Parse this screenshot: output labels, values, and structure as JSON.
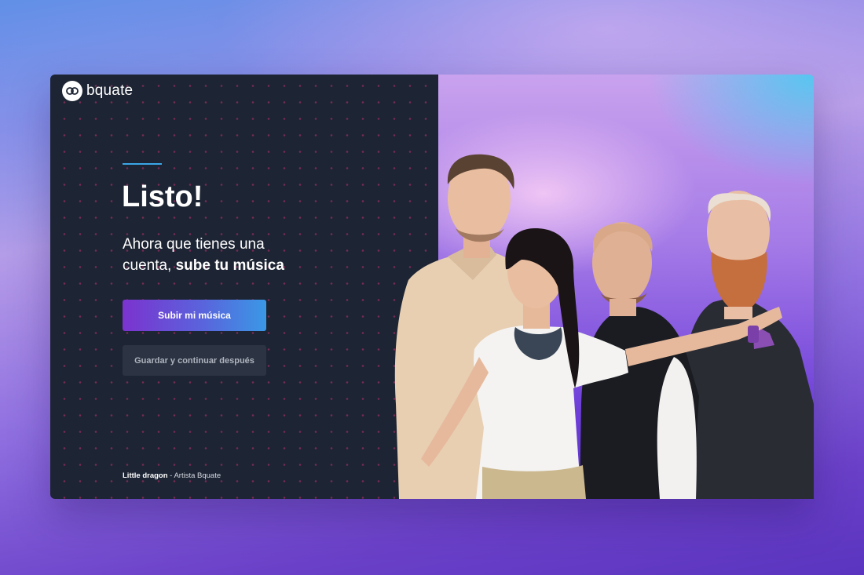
{
  "brand": {
    "name": "bquate",
    "logo_icon": "bquate-logo-icon"
  },
  "main": {
    "headline": "Listo!",
    "subhead_line1": "Ahora que tienes una",
    "subhead_line2_prefix": "cuenta, ",
    "subhead_line2_bold": "sube tu música"
  },
  "actions": {
    "primary_label": "Subir mi música",
    "secondary_label": "Guardar y continuar después"
  },
  "credit": {
    "name": "Little dragon",
    "separator": " - ",
    "role": "Artista Bquate"
  },
  "colors": {
    "panel_bg": "#1d2433",
    "accent_line": "#3aa6e8",
    "primary_gradient_start": "#7b33cf",
    "primary_gradient_end": "#3a98e6",
    "secondary_button_bg": "#2c3342",
    "dot_pattern": "#be326e"
  },
  "hero_image": {
    "subject": "band-photo"
  }
}
